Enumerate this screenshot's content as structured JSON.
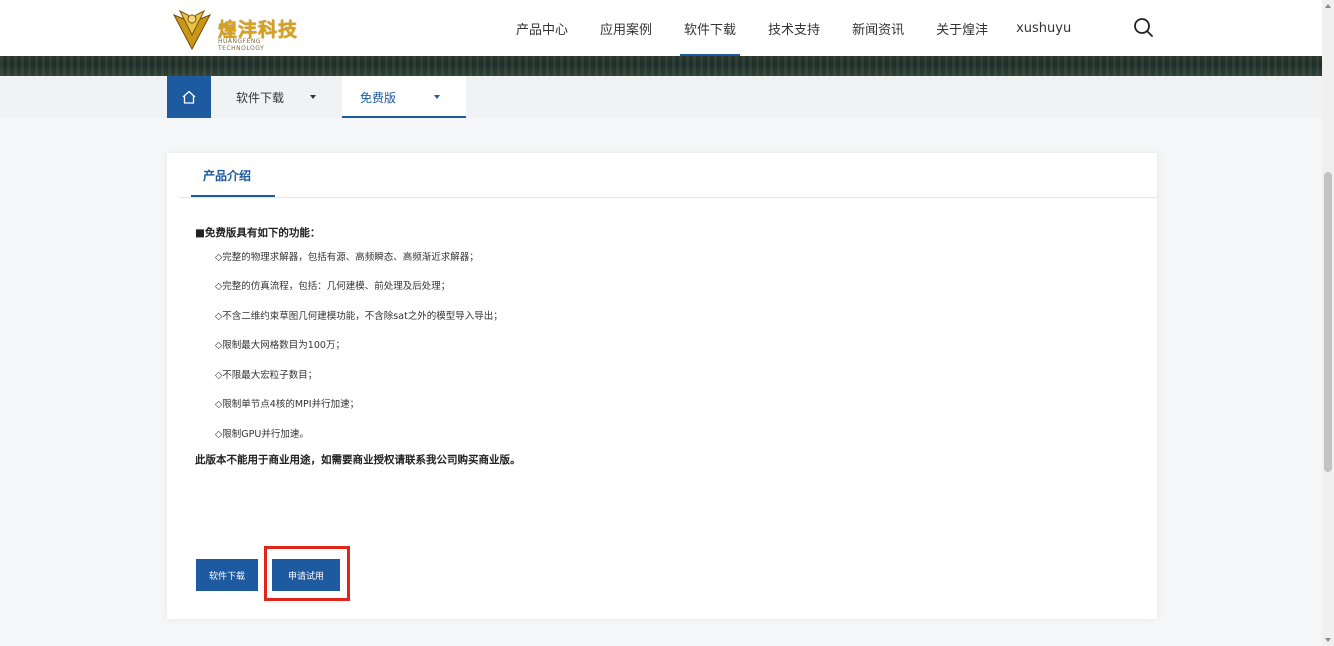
{
  "header": {
    "logo_text": "煌沣科技",
    "logo_sub": "HUANGFENG TECHNOLOGY",
    "nav": [
      {
        "label": "产品中心"
      },
      {
        "label": "应用案例"
      },
      {
        "label": "软件下载"
      },
      {
        "label": "技术支持"
      },
      {
        "label": "新闻资讯"
      },
      {
        "label": "关于煌沣"
      }
    ],
    "user": "xushuyu",
    "colors": {
      "accent": "#1e5aa0",
      "highlight": "#e2241b",
      "logo": "#d9a21c"
    }
  },
  "breadcrumb": {
    "home_icon": "home-icon",
    "level1": "软件下载",
    "level2": "免费版"
  },
  "card": {
    "tab": "产品介绍",
    "heading": "■免费版具有如下的功能：",
    "items": [
      "◇完整的物理求解器，包括有源、高频瞬态、高频渐近求解器；",
      "◇完整的仿真流程，包括：几何建模、前处理及后处理；",
      "◇不含二维约束草图几何建模功能，不含除sat之外的模型导入导出；",
      "◇限制最大网格数目为100万；",
      "◇不限最大宏粒子数目；",
      "◇限制单节点4核的MPI并行加速；",
      "◇限制GPU并行加速。"
    ],
    "note": "此版本不能用于商业用途，如需要商业授权请联系我公司购买商业版。",
    "buttons": {
      "download": "软件下载",
      "trial": "申请试用"
    }
  }
}
